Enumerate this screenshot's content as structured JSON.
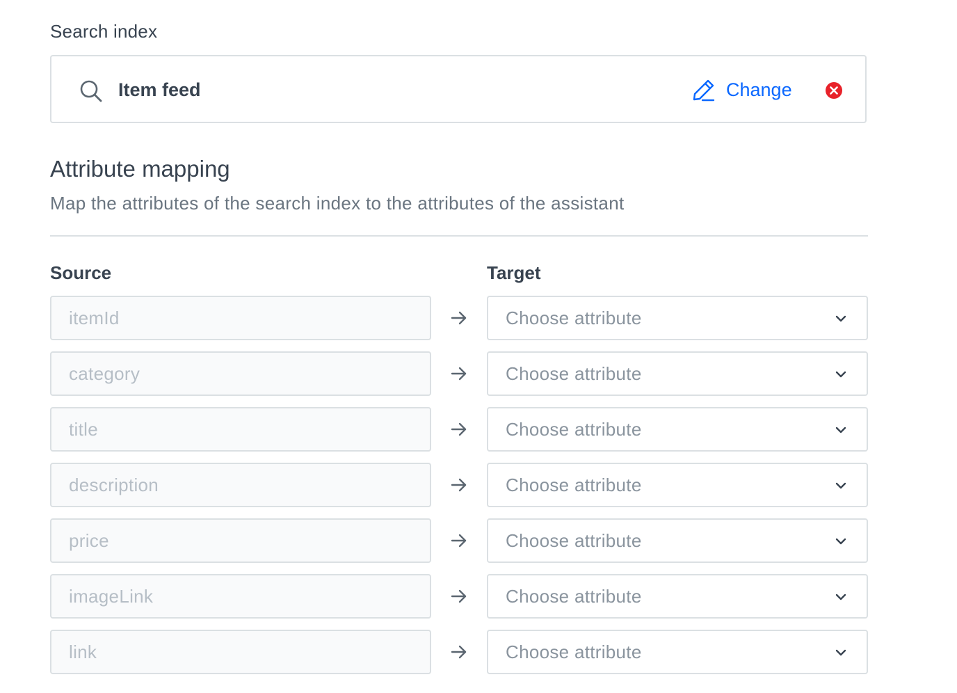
{
  "search_index": {
    "label": "Search index",
    "value": "Item feed",
    "change_label": "Change",
    "icons": {
      "search": "search-icon",
      "change": "pencil-icon",
      "remove": "remove-circle-icon"
    },
    "accent_color": "#0b68ff",
    "remove_color": "#e8222a"
  },
  "attribute_mapping": {
    "title": "Attribute mapping",
    "description": "Map the attributes of the search index to the attributes of the assistant",
    "source_header": "Source",
    "target_header": "Target",
    "rows": [
      {
        "source": "itemId",
        "target_placeholder": "Choose attribute"
      },
      {
        "source": "category",
        "target_placeholder": "Choose attribute"
      },
      {
        "source": "title",
        "target_placeholder": "Choose attribute"
      },
      {
        "source": "description",
        "target_placeholder": "Choose attribute"
      },
      {
        "source": "price",
        "target_placeholder": "Choose attribute"
      },
      {
        "source": "imageLink",
        "target_placeholder": "Choose attribute"
      },
      {
        "source": "link",
        "target_placeholder": "Choose attribute"
      }
    ]
  }
}
